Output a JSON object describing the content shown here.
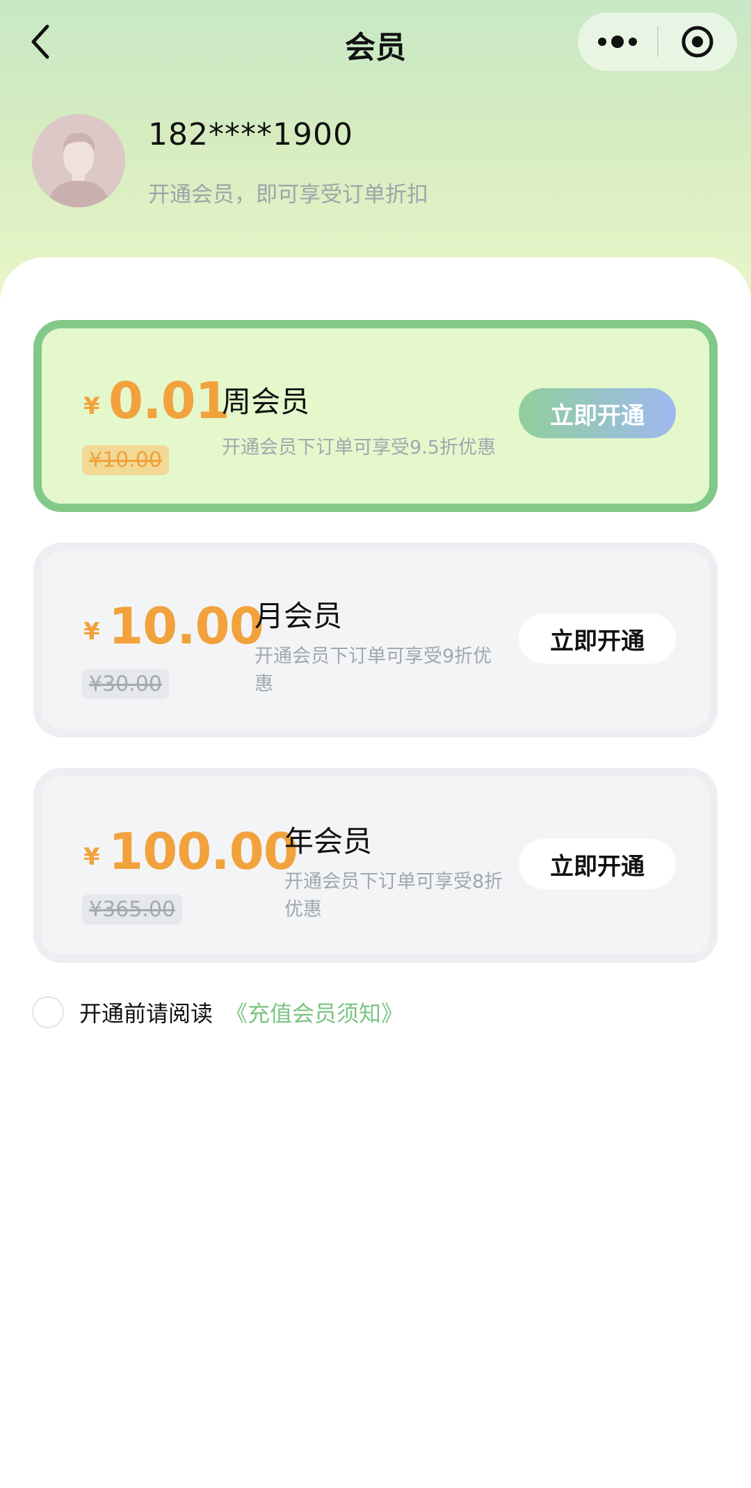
{
  "nav": {
    "title": "会员"
  },
  "profile": {
    "phone": "182****1900",
    "subtitle": "开通会员，即可享受订单折扣"
  },
  "plans": [
    {
      "currency": "¥",
      "price": "0.01",
      "original_price": "¥10.00",
      "name": "周会员",
      "description": "开通会员下订单可享受9.5折优惠",
      "button": "立即开通",
      "selected": true
    },
    {
      "currency": "¥",
      "price": "10.00",
      "original_price": "¥30.00",
      "name": "月会员",
      "description": "开通会员下订单可享受9折优惠",
      "button": "立即开通",
      "selected": false
    },
    {
      "currency": "¥",
      "price": "100.00",
      "original_price": "¥365.00",
      "name": "年会员",
      "description": "开通会员下订单可享受8折优惠",
      "button": "立即开通",
      "selected": false
    }
  ],
  "agreement": {
    "text": "开通前请阅读",
    "link": "《充值会员须知》",
    "checked": false
  },
  "colors": {
    "accent_green": "#82c889",
    "price_orange": "#f2a23c",
    "link_green": "#7cc482"
  }
}
